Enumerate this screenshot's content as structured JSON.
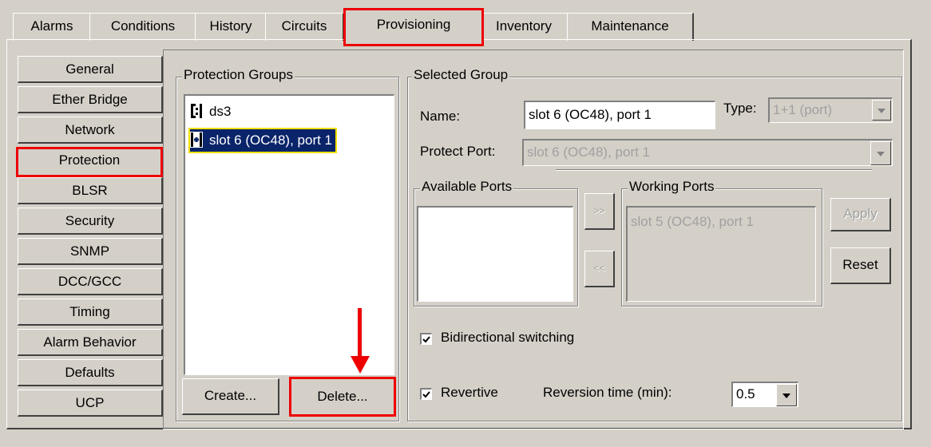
{
  "tabs": [
    {
      "label": "Alarms"
    },
    {
      "label": "Conditions"
    },
    {
      "label": "History"
    },
    {
      "label": "Circuits"
    },
    {
      "label": "Provisioning"
    },
    {
      "label": "Inventory"
    },
    {
      "label": "Maintenance"
    }
  ],
  "nav": [
    {
      "label": "General"
    },
    {
      "label": "Ether Bridge"
    },
    {
      "label": "Network"
    },
    {
      "label": "Protection"
    },
    {
      "label": "BLSR"
    },
    {
      "label": "Security"
    },
    {
      "label": "SNMP"
    },
    {
      "label": "DCC/GCC"
    },
    {
      "label": "Timing"
    },
    {
      "label": "Alarm Behavior"
    },
    {
      "label": "Defaults"
    },
    {
      "label": "UCP"
    }
  ],
  "protection_groups": {
    "title": "Protection Groups",
    "items": [
      {
        "label": "ds3",
        "icon": "one-to-n-protection-icon"
      },
      {
        "label": "slot  6 (OC48), port 1",
        "icon": "one-plus-one-protection-icon"
      }
    ],
    "create_label": "Create...",
    "delete_label": "Delete..."
  },
  "selected_group": {
    "title": "Selected Group",
    "name_label": "Name:",
    "name_value": "slot  6 (OC48), port 1",
    "type_label": "Type:",
    "type_value": "1+1 (port)",
    "protect_port_label": "Protect Port:",
    "protect_port_value": "slot  6 (OC48), port 1",
    "available_ports_title": "Available Ports",
    "working_ports_title": "Working Ports",
    "working_ports_items": [
      "slot  5 (OC48), port 1"
    ],
    "move_right_label": ">>",
    "move_left_label": "<<",
    "apply_label": "Apply",
    "reset_label": "Reset",
    "bidirectional_label": "Bidirectional switching",
    "bidirectional_checked": true,
    "revertive_label": "Revertive",
    "revertive_checked": true,
    "reversion_time_label": "Reversion time (min):",
    "reversion_time_value": "0.5"
  },
  "colors": {
    "highlight": "#e00000",
    "selection": "#0a246a",
    "background": "#d4d0c8"
  }
}
